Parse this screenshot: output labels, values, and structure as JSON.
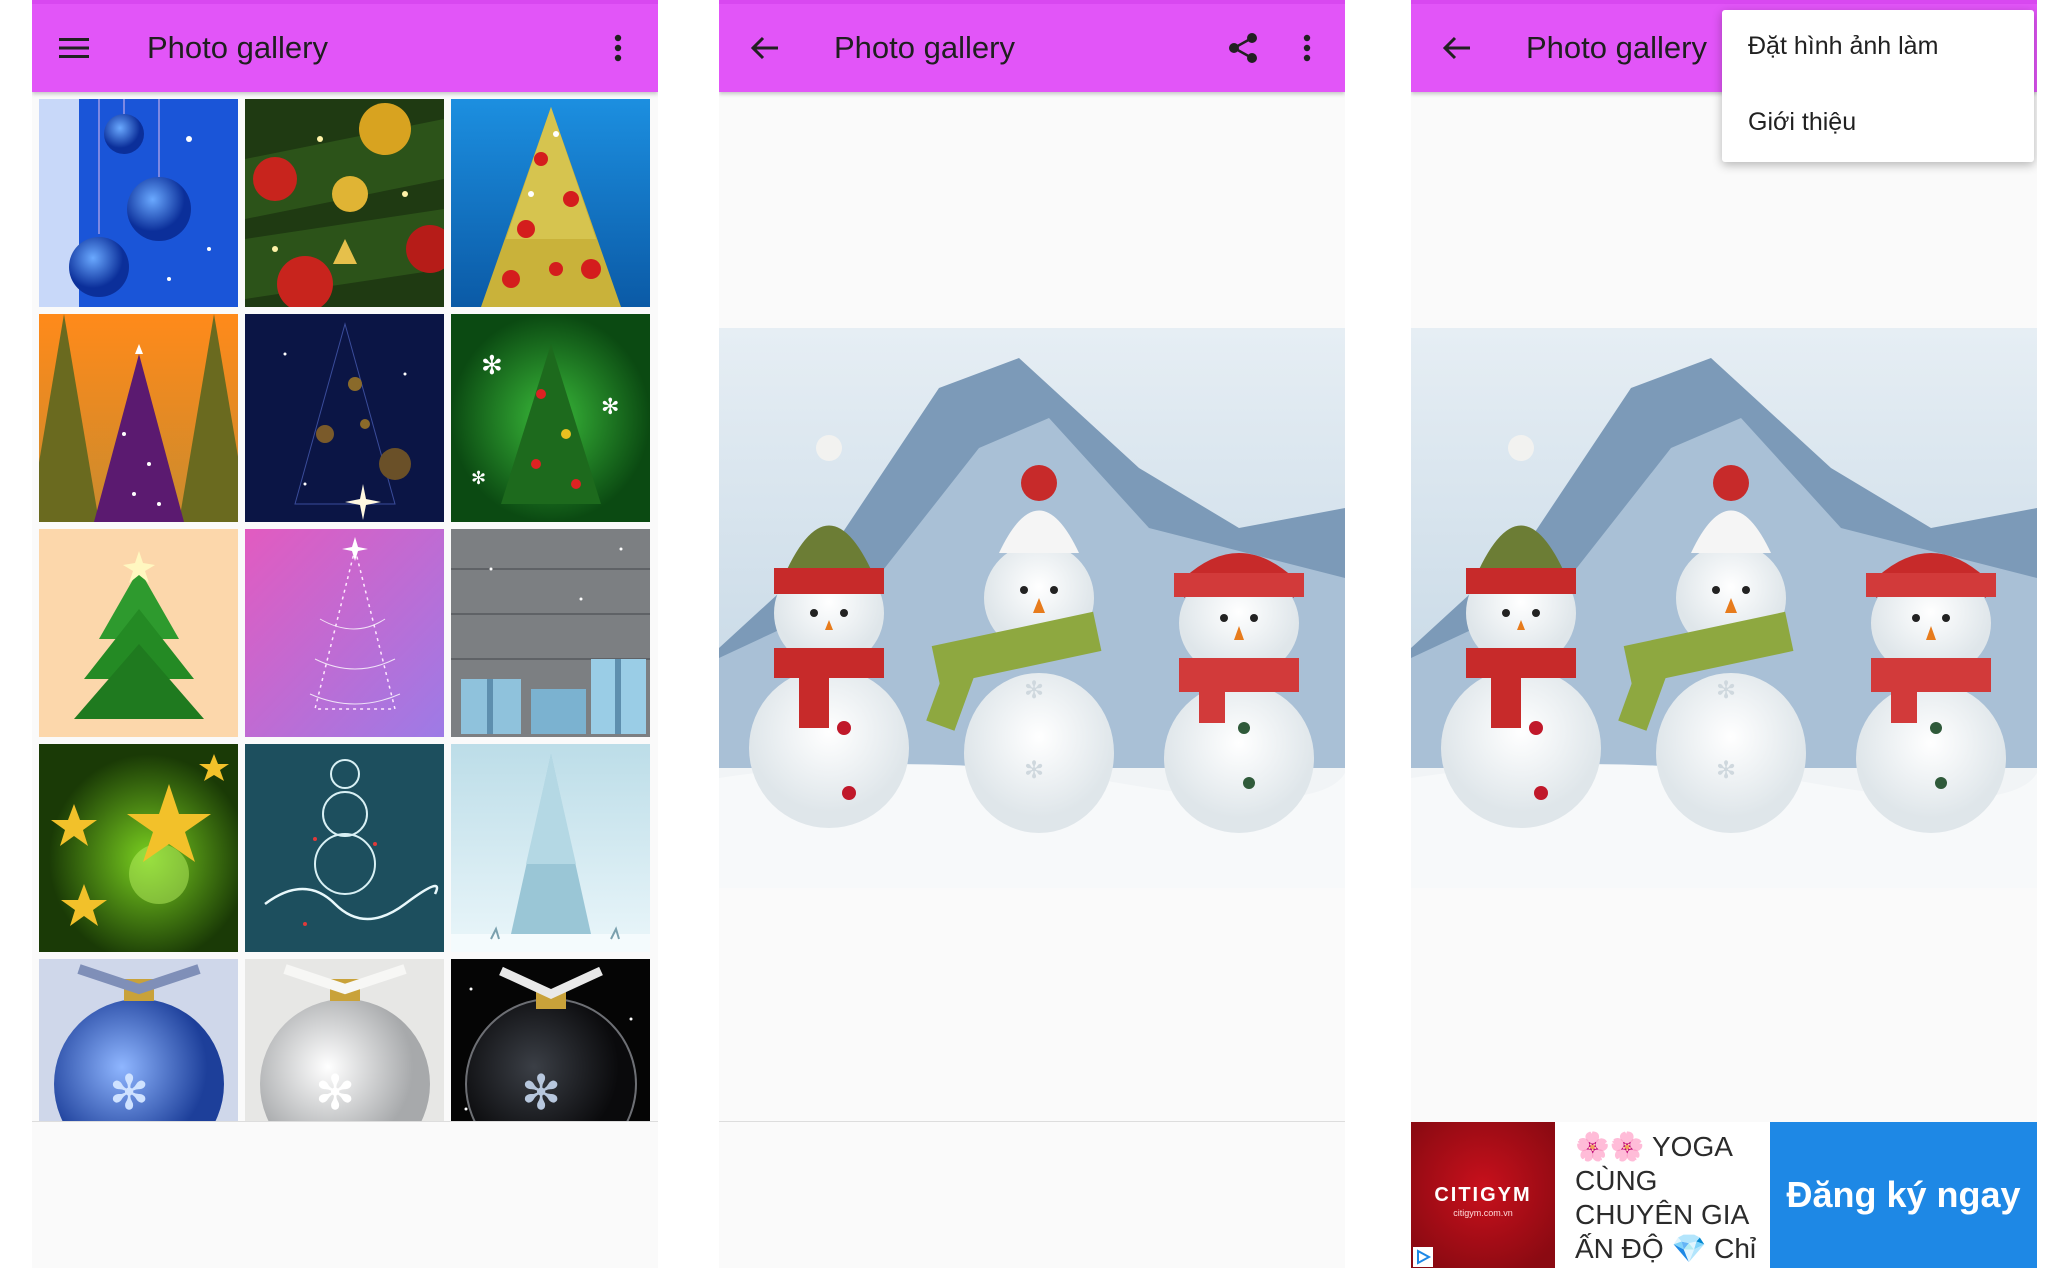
{
  "colors": {
    "appbar": "#e255f8",
    "appbar_border": "#d848f0",
    "background": "#fafafa",
    "ad_cta": "#1e88e5",
    "ad_logo": "#b20e18"
  },
  "gallery_screen": {
    "title": "Photo gallery",
    "menu_icon": "hamburger-icon",
    "overflow_icon": "more-vert-icon",
    "thumbnails": [
      {
        "subject": "blue christmas baubles with snowflakes"
      },
      {
        "subject": "christmas tree with ornaments and lights"
      },
      {
        "subject": "decorated christmas tree on blue background"
      },
      {
        "subject": "purple lit tree among pines at sunset"
      },
      {
        "subject": "starry christmas tree on dark navy"
      },
      {
        "subject": "christmas tree on green bokeh with snowflakes"
      },
      {
        "subject": "paper christmas tree on peach background"
      },
      {
        "subject": "sparkling tree outline on pink purple"
      },
      {
        "subject": "blue gift boxes on grey wood"
      },
      {
        "subject": "golden stars on green bokeh"
      },
      {
        "subject": "light snowman with happy holidays lettering"
      },
      {
        "subject": "frosty tree with reindeer silhouettes"
      },
      {
        "subject": "blue ornament with silver ribbon"
      },
      {
        "subject": "silver ornament with white bow"
      },
      {
        "subject": "clear ornament on black starry background"
      }
    ]
  },
  "detail_screen": {
    "title": "Photo gallery",
    "back_icon": "arrow-back-icon",
    "share_icon": "share-icon",
    "overflow_icon": "more-vert-icon",
    "photo_subject": "three snowmen with knitted hats and scarves in snow"
  },
  "menu_screen": {
    "title": "Photo gallery",
    "back_icon": "arrow-back-icon",
    "menu_items": [
      "Đặt hình ảnh làm",
      "Giới thiệu"
    ],
    "ad": {
      "brand": "CITIGYM",
      "brand_url": "citigym.com.vn",
      "text_line1": "🌸🌸 YOGA",
      "text_line2": "CÙNG",
      "text_line3": "CHUYÊN GIA",
      "text_line4": "ẤN ĐỘ 💎 Chỉ",
      "cta": "Đăng ký ngay"
    }
  }
}
